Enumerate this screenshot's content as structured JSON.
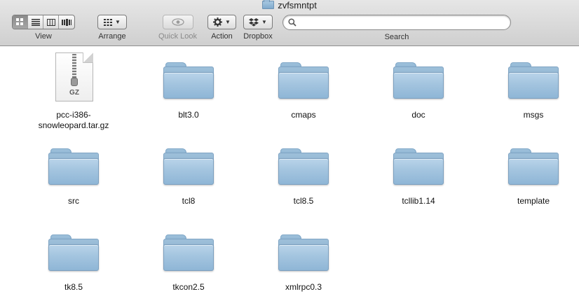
{
  "window": {
    "title": "zvfsmntpt"
  },
  "toolbar": {
    "view_label": "View",
    "arrange_label": "Arrange",
    "quicklook_label": "Quick Look",
    "action_label": "Action",
    "dropbox_label": "Dropbox",
    "search_label": "Search",
    "search_value": "",
    "view_modes": [
      "icon-view",
      "list-view",
      "column-view",
      "cover-flow-view"
    ],
    "active_view_mode": "icon-view"
  },
  "files": [
    {
      "name": "pcc-i386-snowleopard.tar.gz",
      "kind": "archive",
      "ext": "GZ"
    },
    {
      "name": "blt3.0",
      "kind": "folder"
    },
    {
      "name": "cmaps",
      "kind": "folder"
    },
    {
      "name": "doc",
      "kind": "folder"
    },
    {
      "name": "msgs",
      "kind": "folder"
    },
    {
      "name": "src",
      "kind": "folder"
    },
    {
      "name": "tcl8",
      "kind": "folder"
    },
    {
      "name": "tcl8.5",
      "kind": "folder"
    },
    {
      "name": "tcllib1.14",
      "kind": "folder"
    },
    {
      "name": "template",
      "kind": "folder"
    },
    {
      "name": "tk8.5",
      "kind": "folder"
    },
    {
      "name": "tkcon2.5",
      "kind": "folder"
    },
    {
      "name": "xmlrpc0.3",
      "kind": "folder"
    }
  ],
  "colors": {
    "folder_blue": "#a3c4df",
    "toolbar_bg": "#dcdcdc"
  }
}
